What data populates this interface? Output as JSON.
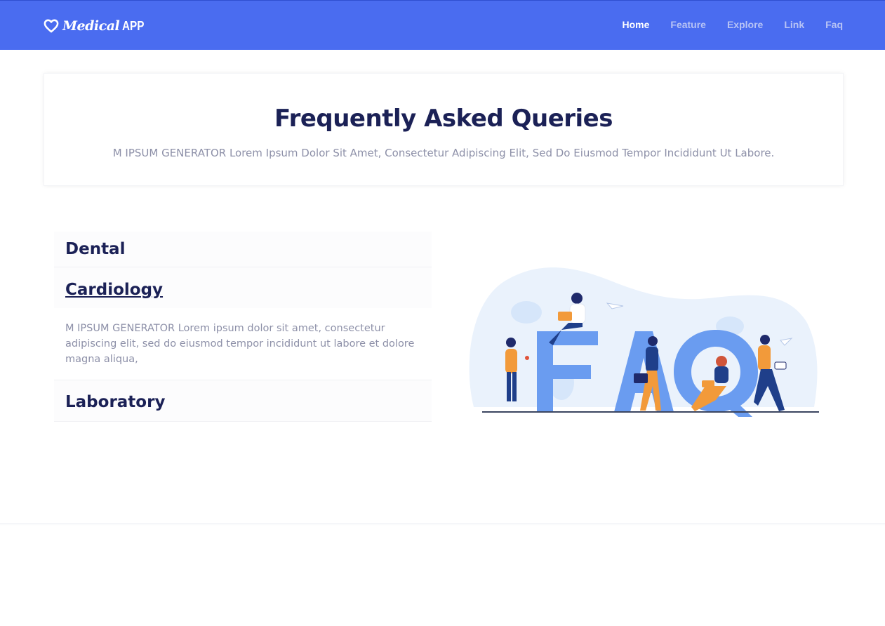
{
  "header": {
    "brand_name": "Medical",
    "brand_suffix": "APP",
    "nav": [
      "Home",
      "Feature",
      "Explore",
      "Link",
      "Faq"
    ],
    "active_nav": "Home",
    "background_color": "#4a6cf0"
  },
  "hero": {
    "title": "Frequently Asked Queries",
    "subtitle": "M IPSUM GENERATOR Lorem Ipsum Dolor Sit Amet, Consectetur Adipiscing Elit, Sed Do Eiusmod Tempor Incididunt Ut Labore."
  },
  "faq": {
    "items": [
      {
        "title": "Dental",
        "open": false
      },
      {
        "title": "Cardiology",
        "open": true,
        "body": "M IPSUM GENERATOR Lorem ipsum dolor sit amet, consectetur adipiscing elit, sed do eiusmod tempor incididunt ut labore et dolore magna aliqua,"
      },
      {
        "title": "Laboratory",
        "open": false
      }
    ]
  },
  "illustration": {
    "letters": "FAQ",
    "icon": "faq-people-illustration"
  },
  "colors": {
    "heading": "#1b2156",
    "muted_text": "#8d90a8",
    "accent_blue": "#6a9cf0",
    "accent_orange": "#f29a3a"
  }
}
